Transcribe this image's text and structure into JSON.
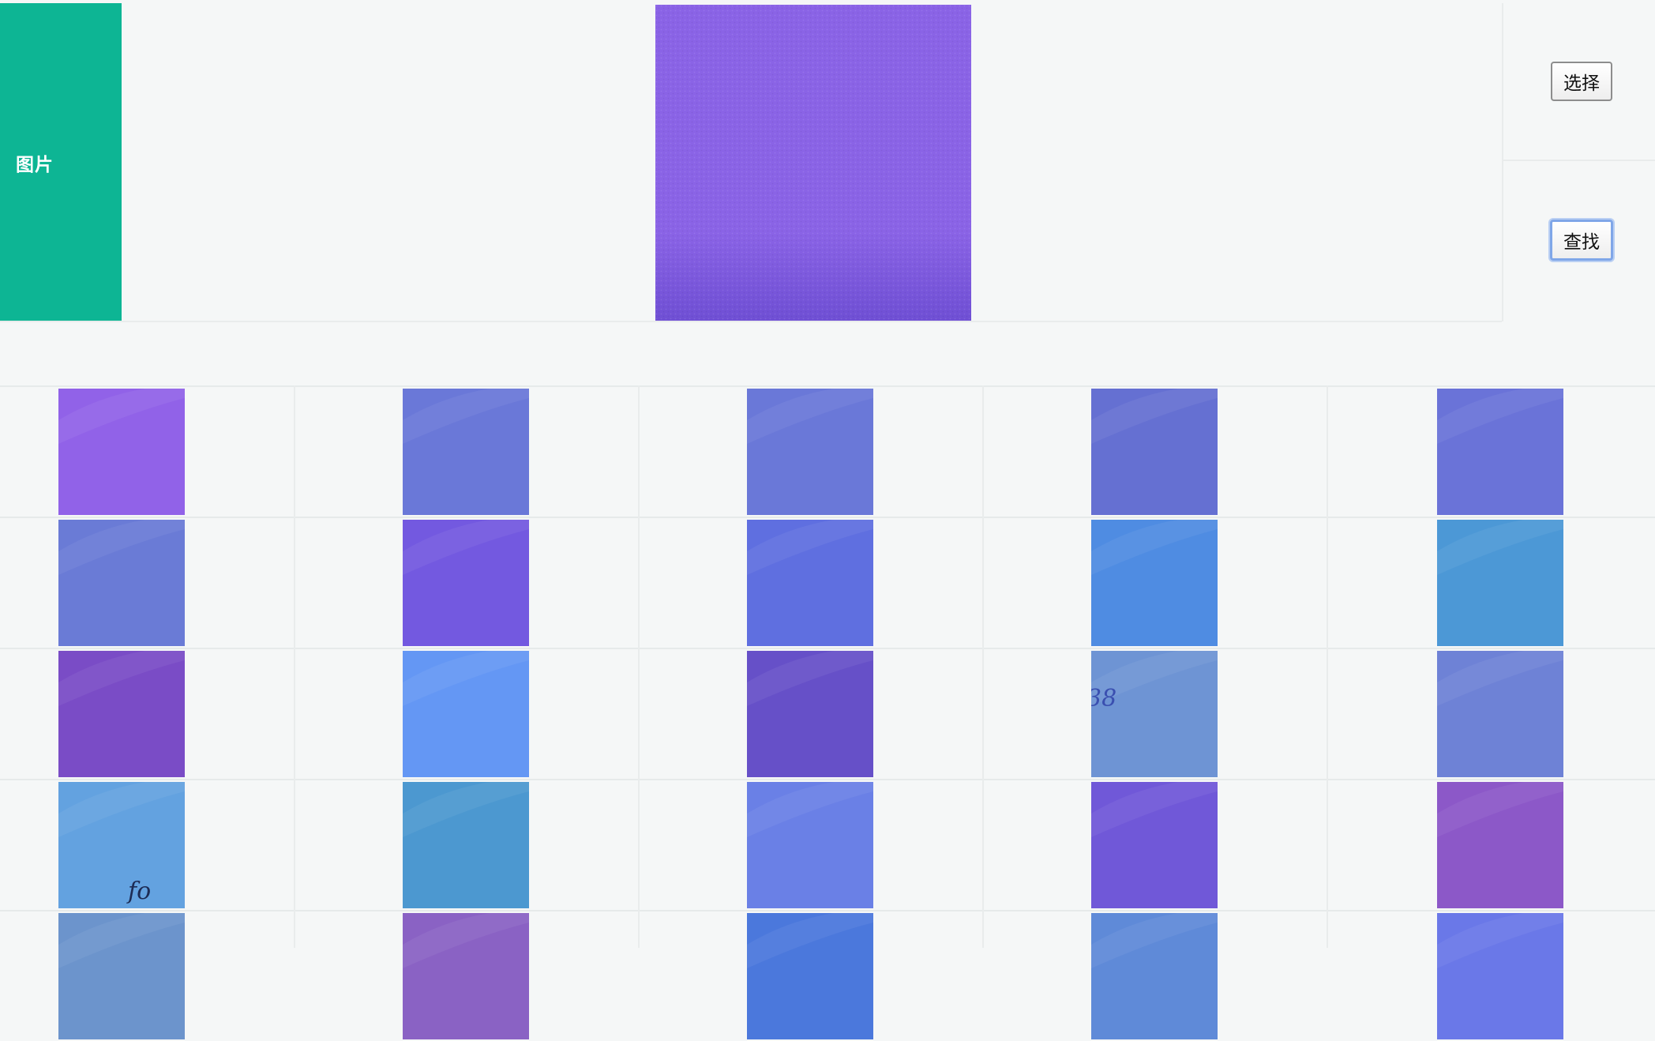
{
  "form": {
    "image_label": "图片",
    "preview": {
      "fill_color": "#8a63e6",
      "bottom_shade": "#6f4fd4"
    }
  },
  "actions": {
    "select_label": "选择",
    "search_label": "查找"
  },
  "results": {
    "rows": [
      [
        {
          "color": "#9162e8",
          "icon": "fabric-swatch"
        },
        {
          "color": "#6a78d8",
          "icon": "fabric-swatch"
        },
        {
          "color": "#6a78d8",
          "icon": "fabric-swatch"
        },
        {
          "color": "#6570d2",
          "icon": "fabric-swatch"
        },
        {
          "color": "#6a73d8",
          "icon": "fabric-swatch"
        }
      ],
      [
        {
          "color": "#6a7bd6",
          "icon": "fabric-swatch"
        },
        {
          "color": "#7359e0",
          "icon": "fabric-swatch"
        },
        {
          "color": "#5f6fe0",
          "icon": "fabric-swatch"
        },
        {
          "color": "#4f8ce2",
          "icon": "fabric-swatch"
        },
        {
          "color": "#4c98d6",
          "icon": "fabric-swatch"
        }
      ],
      [
        {
          "color": "#7a4cc6",
          "icon": "fabric-swatch"
        },
        {
          "color": "#6497f4",
          "icon": "fabric-swatch"
        },
        {
          "color": "#6650c8",
          "icon": "fabric-swatch"
        },
        {
          "color": "#6e94d4",
          "icon": "fabric-swatch",
          "marking": "38"
        },
        {
          "color": "#6e82d6",
          "icon": "fabric-swatch"
        }
      ],
      [
        {
          "color": "#63a2e0",
          "icon": "fabric-swatch",
          "marking": "fo"
        },
        {
          "color": "#4c98d0",
          "icon": "fabric-swatch"
        },
        {
          "color": "#6a80e6",
          "icon": "fabric-swatch"
        },
        {
          "color": "#7058d8",
          "icon": "fabric-swatch"
        },
        {
          "color": "#8c58c8",
          "icon": "fabric-swatch"
        }
      ],
      [
        {
          "color": "#6c94cc",
          "icon": "fabric-swatch"
        },
        {
          "color": "#8a62c4",
          "icon": "fabric-swatch"
        },
        {
          "color": "#4b78dc",
          "icon": "fabric-swatch"
        },
        {
          "color": "#5f8ad8",
          "icon": "fabric-swatch"
        },
        {
          "color": "#6a78e8",
          "icon": "fabric-swatch"
        }
      ]
    ]
  }
}
